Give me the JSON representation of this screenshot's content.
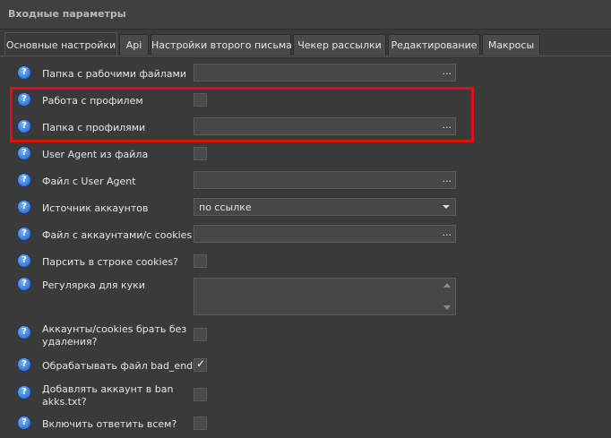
{
  "panel": {
    "title": "Входные параметры"
  },
  "tabs": [
    {
      "label": "Основные настройки",
      "active": true
    },
    {
      "label": "Api"
    },
    {
      "label": "Настройки второго письма"
    },
    {
      "label": "Чекер рассылки"
    },
    {
      "label": "Редактирование"
    },
    {
      "label": "Макросы"
    }
  ],
  "help_glyph": "?",
  "dots": "...",
  "rows": [
    {
      "label": "Папка с рабочими файлами",
      "type": "file",
      "value": ""
    },
    {
      "label": "Работа с профилем",
      "type": "checkbox",
      "checked": false
    },
    {
      "label": "Папка с профилями",
      "type": "file",
      "value": ""
    },
    {
      "label": "User Agent из файла",
      "type": "checkbox",
      "checked": false
    },
    {
      "label": "Файл с User Agent",
      "type": "file",
      "value": ""
    },
    {
      "label": "Источник аккаунтов",
      "type": "select",
      "value": "по ссылке"
    },
    {
      "label": "Файл с аккаунтами/с cookies",
      "type": "file",
      "value": ""
    },
    {
      "label": "Парсить в строке cookies?",
      "type": "checkbox",
      "checked": false
    },
    {
      "label": "Регулярка для куки",
      "type": "textarea",
      "value": ""
    },
    {
      "label_line1": "Аккаунты/cookies брать без",
      "label_line2": "удаления?",
      "type": "checkbox",
      "checked": false
    },
    {
      "label": "Обрабатывать файл bad_end?",
      "type": "checkbox",
      "checked": true
    },
    {
      "label_line1": "Добавлять аккаунт в ban",
      "label_line2": "akks.txt?",
      "type": "checkbox",
      "checked": false
    },
    {
      "label": "Включить ответить всем?",
      "type": "checkbox",
      "checked": false
    }
  ],
  "check_glyph": "✓",
  "colors": {
    "highlight": "#e0100f",
    "help_icon": "#2f7fe6"
  }
}
